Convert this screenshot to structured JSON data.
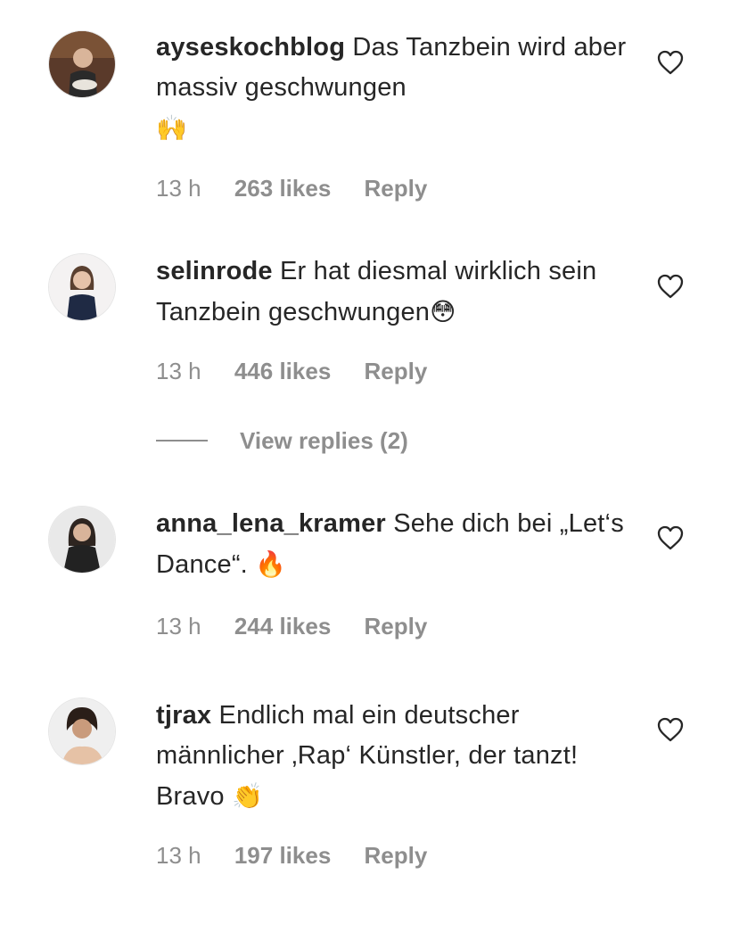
{
  "comments": [
    {
      "username": "ayseskochblog",
      "text": "Das Tanzbein wird aber massiv geschwungen",
      "emoji": "🙌",
      "time": "13 h",
      "likes": "263 likes",
      "reply": "Reply"
    },
    {
      "username": "selinrode",
      "text": "Er hat diesmal wirklich sein Tanzbein geschwungen",
      "emoji": "😳",
      "time": "13 h",
      "likes": "446 likes",
      "reply": "Reply",
      "view_replies": "View replies (2)"
    },
    {
      "username": "anna_lena_kramer",
      "text": "Sehe dich bei „Let‘s Dance“.",
      "emoji": "🔥",
      "time": "13 h",
      "likes": "244 likes",
      "reply": "Reply"
    },
    {
      "username": "tjrax",
      "text": "Endlich mal ein deutscher männlicher ‚Rap‘ Künstler, der tanzt! Bravo",
      "emoji": "👏",
      "time": "13 h",
      "likes": "197 likes",
      "reply": "Reply"
    }
  ],
  "icons": {
    "like": "heart-outline-icon"
  },
  "colors": {
    "text": "#262626",
    "secondary": "#8e8e8e"
  }
}
